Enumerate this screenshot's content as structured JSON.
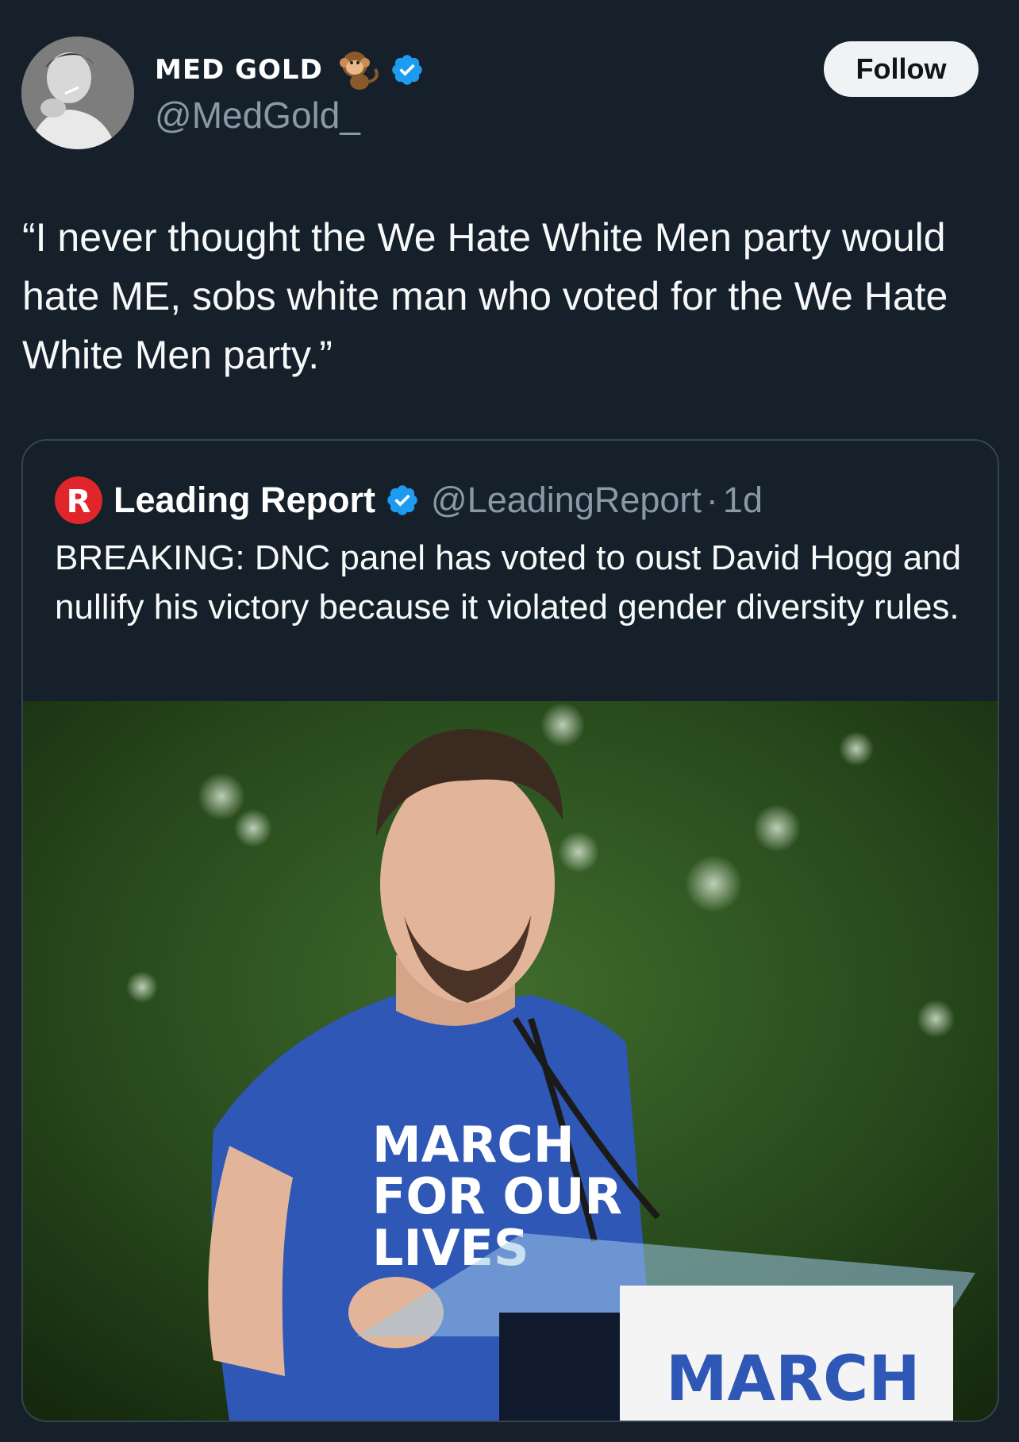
{
  "author": {
    "display_name": "MED GOLD",
    "emoji_icon": "monkey-emoji",
    "handle": "@MedGold_",
    "verified": true
  },
  "follow_label": "Follow",
  "tweet": {
    "text": "“I never thought the We Hate White Men party would hate ME, sobs white man who voted for the We Hate White Men party.”"
  },
  "quoted": {
    "logo_icon": "leading-report-logo",
    "name": "Leading Report",
    "verified": true,
    "handle": "@LeadingReport",
    "separator": "·",
    "time": "1d",
    "text": "BREAKING: DNC panel has voted to oust David Hogg and nullify his victory because it violated gender diversity rules.",
    "media": {
      "shirt_text": [
        "MARCH",
        "FOR OUR",
        "LIVES"
      ],
      "podium_sign": "MARCH"
    }
  },
  "colors": {
    "background": "#15202b",
    "verified_blue": "#1d9bf0",
    "secondary_text": "#8b98a5",
    "border": "#38444d"
  }
}
